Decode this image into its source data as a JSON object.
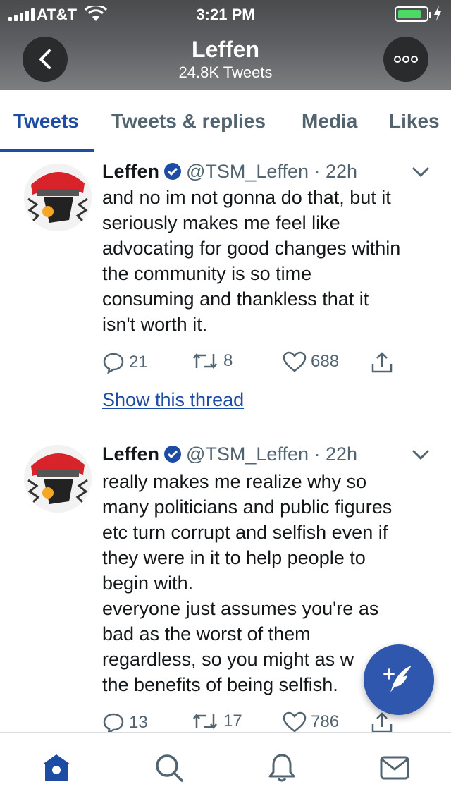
{
  "status_bar": {
    "carrier": "AT&T",
    "time": "3:21 PM"
  },
  "header": {
    "title": "Leffen",
    "subtitle": "24.8K Tweets"
  },
  "tabs": [
    {
      "label": "Tweets",
      "active": true
    },
    {
      "label": "Tweets & replies",
      "active": false
    },
    {
      "label": "Media",
      "active": false
    },
    {
      "label": "Likes",
      "active": false
    }
  ],
  "tweets": [
    {
      "name": "Leffen",
      "handle": "@TSM_Leffen",
      "time": "· 22h",
      "text": "and no im not gonna do that, but it\nseriously makes me feel like\nadvocating for good changes within\nthe community is so time\nconsuming and thankless that it\nisn't worth it.",
      "replies": "21",
      "retweets": "8",
      "likes": "688",
      "thread_link": "Show this thread"
    },
    {
      "name": "Leffen",
      "handle": "@TSM_Leffen",
      "time": "· 22h",
      "text": "really makes me realize why so\nmany politicians and public figures\netc turn corrupt and selfish even if\nthey were in it to help people to\nbegin with.\neveryone just assumes you're as\nbad as the worst of them\nregardless, so you might as w\nthe benefits of being selfish.",
      "replies": "13",
      "retweets": "17",
      "likes": "786"
    }
  ],
  "colors": {
    "accent": "#1d4ca5",
    "fab": "#2f57ad",
    "battery": "#4cd964"
  },
  "icons": [
    "back-arrow-icon",
    "more-options-icon",
    "verified-badge-icon",
    "chevron-down-icon",
    "reply-icon",
    "retweet-icon",
    "like-icon",
    "share-icon",
    "compose-tweet-icon",
    "home-icon",
    "search-icon",
    "notifications-icon",
    "messages-icon"
  ]
}
